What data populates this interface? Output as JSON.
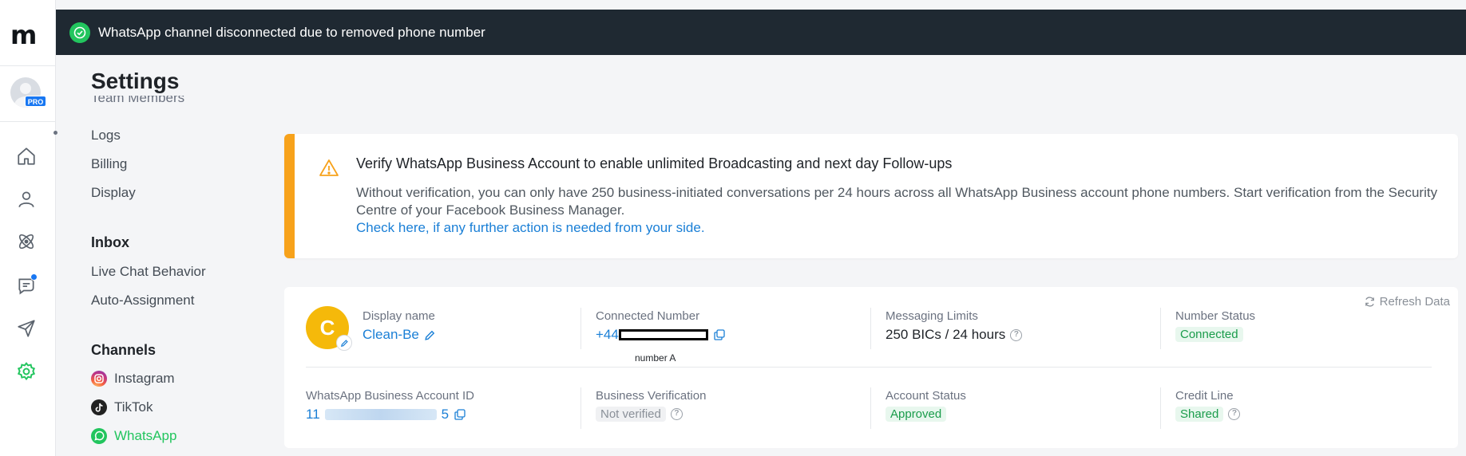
{
  "banner": {
    "message": "WhatsApp channel disconnected due to removed phone number",
    "status_color": "#22c55e"
  },
  "rail": {
    "logo": "m",
    "pro_badge": "PRO",
    "icons": [
      "home-icon",
      "contacts-icon",
      "automation-icon",
      "inbox-icon",
      "broadcast-icon",
      "settings-icon"
    ]
  },
  "page": {
    "title": "Settings"
  },
  "settings_menu": {
    "cut_item": "Team Members",
    "items": [
      "Logs",
      "Billing",
      "Display"
    ],
    "inbox": {
      "heading": "Inbox",
      "items": [
        "Live Chat Behavior",
        "Auto-Assignment"
      ]
    },
    "channels": {
      "heading": "Channels",
      "items": [
        {
          "label": "Instagram",
          "icon": "instagram-icon"
        },
        {
          "label": "TikTok",
          "icon": "tiktok-icon"
        },
        {
          "label": "WhatsApp",
          "icon": "whatsapp-icon",
          "active": true
        }
      ]
    }
  },
  "verify_card": {
    "title": "Verify WhatsApp Business Account to enable unlimited Broadcasting and next day Follow-ups",
    "description": "Without verification, you can only have 250 business-initiated conversations per 24 hours across all WhatsApp Business account phone numbers. Start verification from the Security Centre of your Facebook Business Manager.",
    "link": "Check here, if any further action is needed from your side.",
    "accent": "#f7a21b"
  },
  "account_card": {
    "refresh_label": "Refresh Data",
    "avatar_letter": "C",
    "display_name": {
      "label": "Display name",
      "value": "Clean-Be"
    },
    "connected_number": {
      "label": "Connected Number",
      "value_prefix": "+44",
      "annotation": "number A"
    },
    "messaging_limits": {
      "label": "Messaging Limits",
      "value": "250 BICs / 24 hours"
    },
    "number_status": {
      "label": "Number Status",
      "value": "Connected"
    },
    "waba_id": {
      "label": "WhatsApp Business Account ID",
      "value_prefix": "11",
      "value_suffix": "5"
    },
    "business_verification": {
      "label": "Business Verification",
      "value": "Not verified"
    },
    "account_status": {
      "label": "Account Status",
      "value": "Approved"
    },
    "credit_line": {
      "label": "Credit Line",
      "value": "Shared"
    }
  }
}
